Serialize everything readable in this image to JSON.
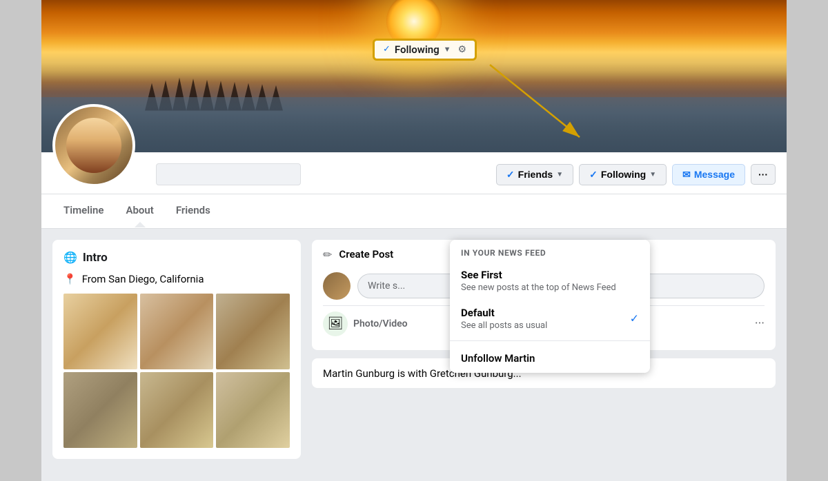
{
  "page": {
    "background_color": "#c8c8c8"
  },
  "cover": {
    "alt": "Sunset beach cover photo"
  },
  "following_highlight": {
    "check": "✓",
    "label": "Following",
    "arrow": "▼",
    "gear": "⚙"
  },
  "profile": {
    "name_placeholder": "",
    "location": "From San Diego, California"
  },
  "action_buttons": {
    "friends_check": "✓",
    "friends_label": "Friends",
    "friends_caret": "▼",
    "following_check": "✓",
    "following_label": "Following",
    "following_caret": "▼",
    "message_icon": "✉",
    "message_label": "Message",
    "more_dots": "···"
  },
  "nav_tabs": [
    {
      "label": "Timeline",
      "active": false
    },
    {
      "label": "About",
      "active": false
    },
    {
      "label": "Friends",
      "active": false
    }
  ],
  "intro": {
    "title": "Intro",
    "globe_icon": "🌐",
    "location_icon": "📍",
    "location": "From San Diego, California"
  },
  "create_post": {
    "pencil": "✏",
    "label": "Create Post",
    "write_placeholder": "Write s...",
    "photo_icon": "🖼",
    "photo_label": "Photo/Video",
    "more_dots": "···"
  },
  "dropdown": {
    "section_label": "IN YOUR NEWS FEED",
    "items": [
      {
        "title": "See First",
        "desc": "See new posts at the top of News Feed",
        "checked": false
      },
      {
        "title": "Default",
        "desc": "See all posts as usual",
        "checked": true
      }
    ],
    "unfollow_label": "Unfollow Martin"
  },
  "post_preview": {
    "author": "Martin Gunburg is with Gretchen Gunburg..."
  }
}
